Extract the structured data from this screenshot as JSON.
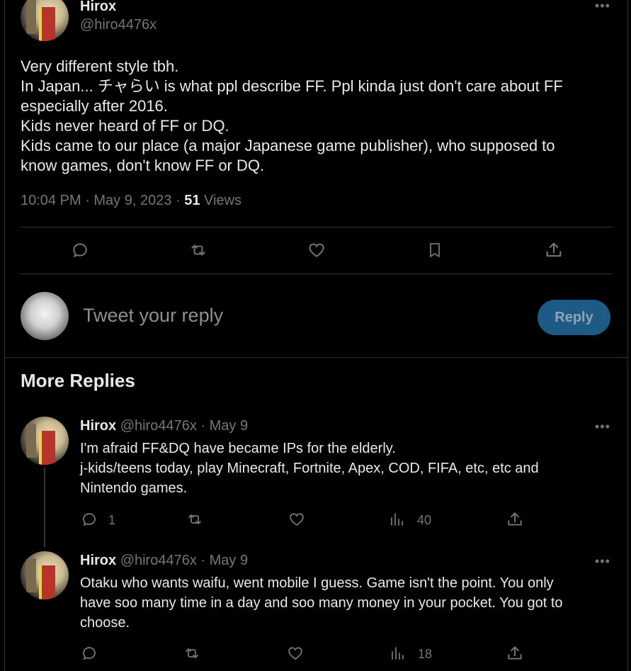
{
  "main_tweet": {
    "author_name": "Hirox",
    "author_handle": "@hiro4476x",
    "lines": [
      "Very different style tbh.",
      "In Japan... チャらい is what ppl describe FF. Ppl kinda just don't care about FF",
      "especially after 2016.",
      "Kids never heard of FF or DQ.",
      "Kids came to our place (a major Japanese game publisher), who supposed to",
      "know games, don't know FF or DQ."
    ],
    "time": "10:04 PM · May 9, 2023 · ",
    "views_count": "51",
    "views_label": " Views"
  },
  "composer": {
    "placeholder": "Tweet your reply",
    "reply_button": "Reply"
  },
  "more_replies": {
    "heading": "More Replies",
    "replies": [
      {
        "author_name": "Hirox",
        "author_handle": "@hiro4476x",
        "date": "May 9",
        "lines": [
          "I'm afraid FF&DQ have became IPs for the elderly.",
          "j-kids/teens today, play Minecraft, Fortnite, Apex, COD, FIFA, etc, etc and",
          "Nintendo games."
        ],
        "reply_count": "1",
        "retweet_count": "",
        "like_count": "",
        "views_count": "40"
      },
      {
        "author_name": "Hirox",
        "author_handle": "@hiro4476x",
        "date": "May 9",
        "lines": [
          "Otaku who wants waifu, went mobile I guess. Game isn't the point. You only",
          "have soo many time in a day and soo many money in your pocket. You got to",
          "choose."
        ],
        "reply_count": "",
        "retweet_count": "",
        "like_count": "",
        "views_count": "18"
      }
    ]
  },
  "icons": {
    "reply": "speech-bubble-icon",
    "retweet": "retweet-icon",
    "like": "heart-icon",
    "bookmark": "bookmark-icon",
    "share": "share-icon",
    "views": "bar-chart-icon",
    "more": "more-icon"
  },
  "colors": {
    "background": "#000000",
    "text": "#e7e9ea",
    "muted": "#71767b",
    "reply_button_bg": "#1d5a85"
  }
}
